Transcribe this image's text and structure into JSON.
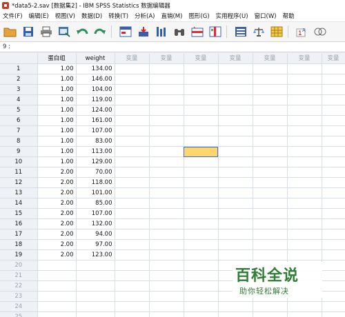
{
  "window": {
    "title": "*data5-2.sav [数据集2] - IBM SPSS Statistics 数据编辑器"
  },
  "menu": [
    "文件(F)",
    "编辑(E)",
    "视图(V)",
    "数据(D)",
    "转换(T)",
    "分析(A)",
    "直销(M)",
    "图形(G)",
    "实用程序(U)",
    "窗口(W)",
    "帮助"
  ],
  "toolbar": {
    "icons": [
      "open-folder-icon",
      "save-icon",
      "print-icon",
      "dialog-recall-icon",
      "undo-icon",
      "redo-icon",
      "goto-case-icon",
      "goto-variable-icon",
      "variables-icon",
      "find-icon",
      "insert-cases-icon",
      "insert-variable-icon",
      "split-file-icon",
      "weight-cases-icon",
      "select-cases-icon",
      "value-labels-icon",
      "use-sets-icon"
    ]
  },
  "cell_editor": {
    "ref": "9 :"
  },
  "grid": {
    "columns": [
      "蛋白组",
      "weight",
      "变量",
      "变量",
      "变量",
      "变量",
      "变量",
      "变量",
      "变量"
    ],
    "rows": [
      {
        "n": "1",
        "group": "1.00",
        "weight": "134.00"
      },
      {
        "n": "2",
        "group": "1.00",
        "weight": "146.00"
      },
      {
        "n": "3",
        "group": "1.00",
        "weight": "104.00"
      },
      {
        "n": "4",
        "group": "1.00",
        "weight": "119.00"
      },
      {
        "n": "5",
        "group": "1.00",
        "weight": "124.00"
      },
      {
        "n": "6",
        "group": "1.00",
        "weight": "161.00"
      },
      {
        "n": "7",
        "group": "1.00",
        "weight": "107.00"
      },
      {
        "n": "8",
        "group": "1.00",
        "weight": "83.00"
      },
      {
        "n": "9",
        "group": "1.00",
        "weight": "113.00"
      },
      {
        "n": "10",
        "group": "1.00",
        "weight": "129.00"
      },
      {
        "n": "11",
        "group": "2.00",
        "weight": "70.00"
      },
      {
        "n": "12",
        "group": "2.00",
        "weight": "118.00"
      },
      {
        "n": "13",
        "group": "2.00",
        "weight": "101.00"
      },
      {
        "n": "14",
        "group": "2.00",
        "weight": "85.00"
      },
      {
        "n": "15",
        "group": "2.00",
        "weight": "107.00"
      },
      {
        "n": "16",
        "group": "2.00",
        "weight": "132.00"
      },
      {
        "n": "17",
        "group": "2.00",
        "weight": "94.00"
      },
      {
        "n": "18",
        "group": "2.00",
        "weight": "97.00"
      },
      {
        "n": "19",
        "group": "2.00",
        "weight": "123.00"
      }
    ],
    "empty_rows": [
      "20",
      "21",
      "22",
      "23",
      "24",
      "25"
    ],
    "selected": {
      "row": "9",
      "col": 4
    }
  },
  "watermark": {
    "main": "百科全说",
    "sub": "助你轻松解决"
  }
}
